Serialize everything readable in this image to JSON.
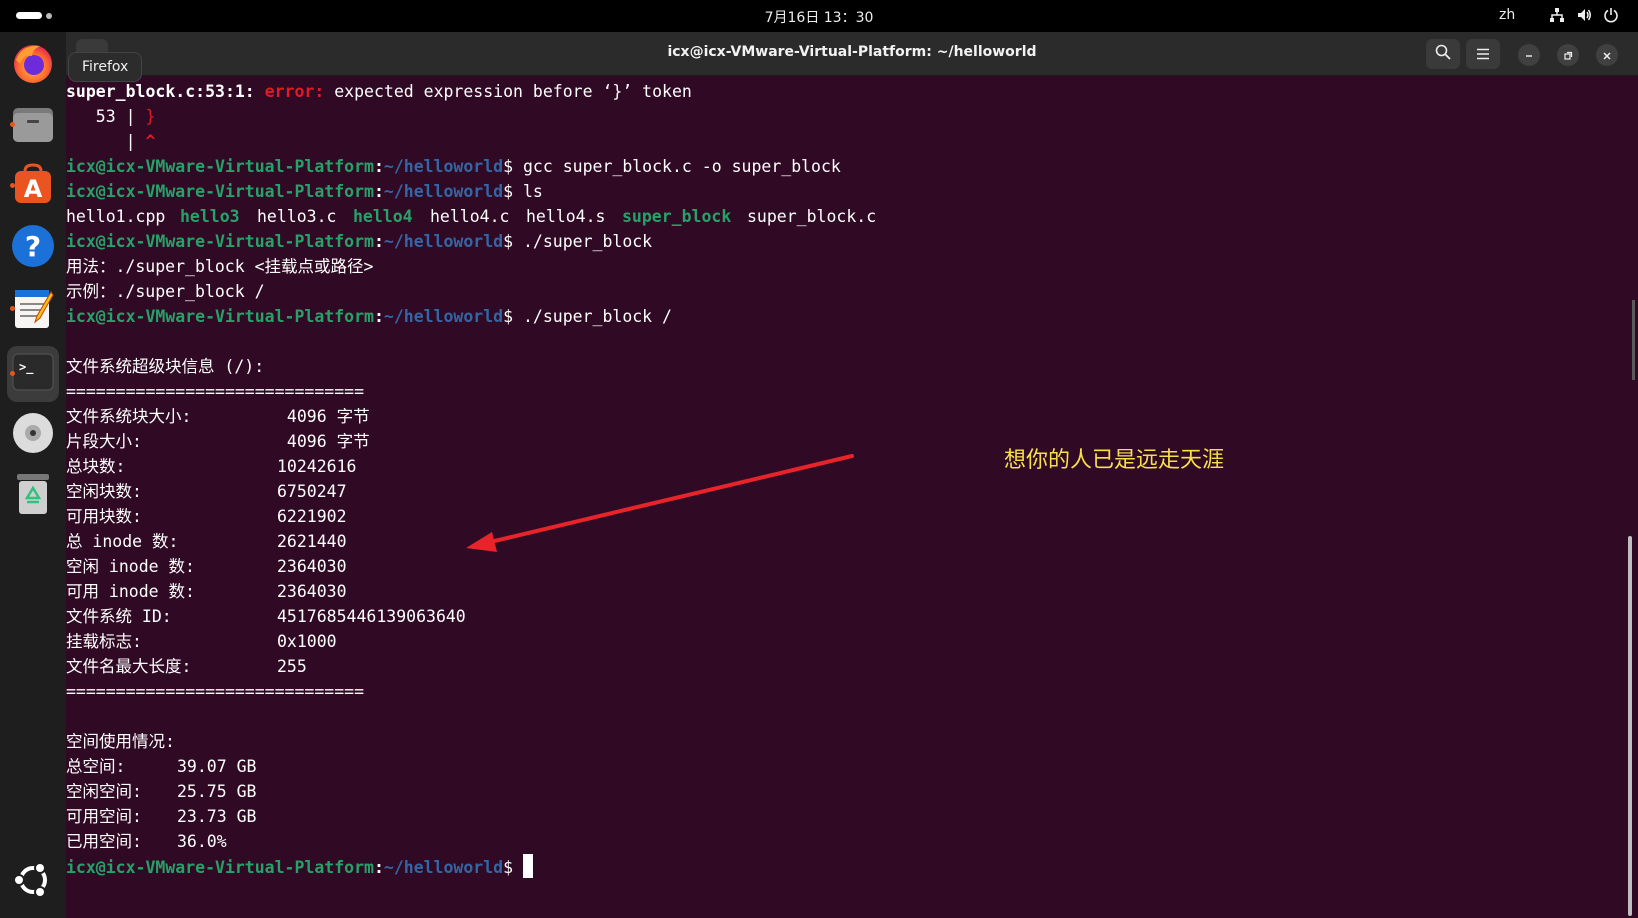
{
  "topbar": {
    "clock": "7月16日 13：30",
    "lang": "zh"
  },
  "dock": {
    "tooltip": "Firefox",
    "items": [
      {
        "name": "firefox",
        "icon": "firefox-icon"
      },
      {
        "name": "files",
        "icon": "folder-icon"
      },
      {
        "name": "app-center",
        "icon": "app-center-icon"
      },
      {
        "name": "help",
        "icon": "help-icon"
      },
      {
        "name": "text-editor",
        "icon": "text-editor-icon"
      },
      {
        "name": "terminal",
        "icon": "terminal-icon"
      },
      {
        "name": "disc",
        "icon": "disc-icon"
      },
      {
        "name": "trash",
        "icon": "trash-icon"
      },
      {
        "name": "show-apps",
        "icon": "ubuntu-logo-icon"
      }
    ]
  },
  "window": {
    "title": "icx@icx-VMware-Virtual-Platform: ~/helloworld"
  },
  "prompt": {
    "user": "icx@icx-VMware-Virtual-Platform",
    "path": "~/helloworld",
    "sep": ":",
    "dollar": "$"
  },
  "terminal": {
    "error": {
      "location": "super_block.c:53:1:",
      "label": "error:",
      "message": " expected expression before ‘}’ token",
      "line_no": "   53 | ",
      "line_code": "}",
      "caret_bar": "      | ",
      "caret": "^"
    },
    "cmd_gcc": " gcc super_block.c -o super_block",
    "cmd_ls": " ls",
    "ls_files": [
      {
        "text": "hello1.cpp",
        "exec": false
      },
      {
        "text": "hello3",
        "exec": true
      },
      {
        "text": "hello3.c",
        "exec": false
      },
      {
        "text": "hello4",
        "exec": true
      },
      {
        "text": "hello4.c",
        "exec": false
      },
      {
        "text": "hello4.s",
        "exec": false
      },
      {
        "text": "super_block",
        "exec": true
      },
      {
        "text": "super_block.c",
        "exec": false
      }
    ],
    "cmd_run1": " ./super_block",
    "usage": "用法：./super_block <挂载点或路径>",
    "example": "示例：./super_block /",
    "cmd_run2": " ./super_block /",
    "fs_header": "文件系统超级块信息 (/):",
    "separator": "==============================",
    "fs_rows": [
      {
        "label": "文件系统块大小:",
        "value": " 4096 字节"
      },
      {
        "label": "片段大小:",
        "value": " 4096 字节"
      },
      {
        "label": "总块数:",
        "value": "10242616"
      },
      {
        "label": "空闲块数:",
        "value": "6750247"
      },
      {
        "label": "可用块数:",
        "value": "6221902"
      },
      {
        "label": "总 inode 数:",
        "value": "2621440"
      },
      {
        "label": "空闲 inode 数:",
        "value": "2364030"
      },
      {
        "label": "可用 inode 数:",
        "value": "2364030"
      },
      {
        "label": "文件系统 ID:",
        "value": "4517685446139063640"
      },
      {
        "label": "挂载标志:",
        "value": "0x1000"
      },
      {
        "label": "文件名最大长度:",
        "value": "255"
      }
    ],
    "space_header": "空间使用情况:",
    "space_rows": [
      {
        "label": "总空间:",
        "value": "39.07 GB"
      },
      {
        "label": "空闲空间:",
        "value": "25.75 GB"
      },
      {
        "label": "可用空间:",
        "value": "23.73 GB"
      },
      {
        "label": "已用空间:",
        "value": "36.0%"
      }
    ]
  },
  "annotation": {
    "text": "想你的人已是远走天涯",
    "text_color": "#f6e04a",
    "arrow_color": "#e8232a"
  },
  "colors": {
    "terminal_bg": "#300a24",
    "prompt_user": "#26a269",
    "prompt_path": "#3465a4",
    "error": "#e01b24"
  }
}
